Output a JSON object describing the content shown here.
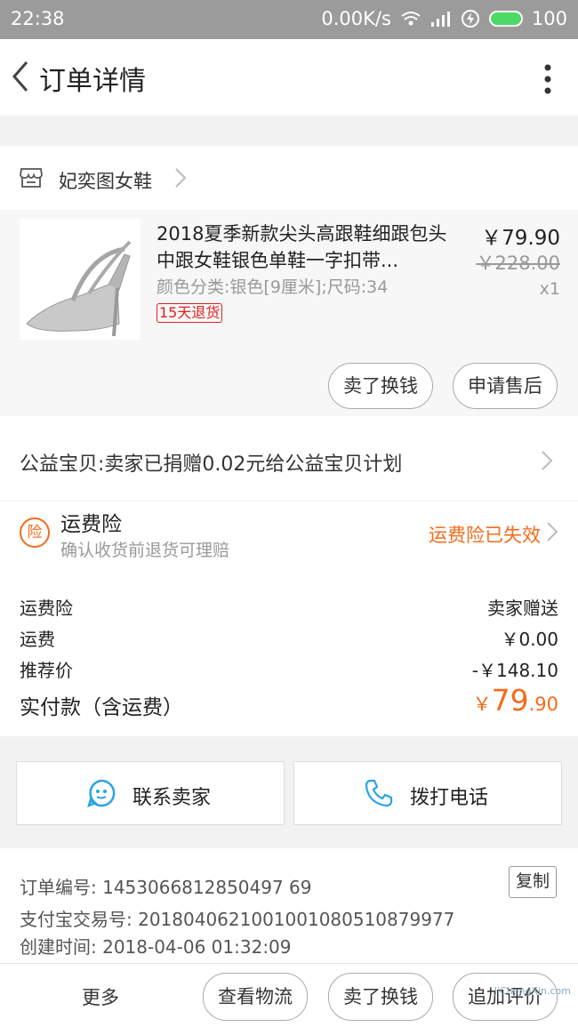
{
  "status_bar": {
    "time": "22:38",
    "network_speed": "0.00K/s",
    "battery": "100"
  },
  "header": {
    "title": "订单详情"
  },
  "shop": {
    "name": "妃奕图女鞋"
  },
  "product": {
    "title": "2018夏季新款尖头高跟鞋细跟包头中跟女鞋银色单鞋一字扣带...",
    "attributes": "颜色分类:银色[9厘米];尺码:34",
    "return_badge": "15天退货",
    "price": "￥79.90",
    "original_price": "￥228.00",
    "quantity": "x1",
    "button_sell": "卖了换钱",
    "button_after_sale": "申请售后"
  },
  "charity": {
    "text": "公益宝贝:卖家已捐赠0.02元给公益宝贝计划"
  },
  "insurance": {
    "icon_char": "险",
    "title": "运费险",
    "subtitle": "确认收货前退货可理赔",
    "status": "运费险已失效"
  },
  "fees": {
    "rows": [
      {
        "label": "运费险",
        "value": "卖家赠送"
      },
      {
        "label": "运费",
        "value": "￥0.00"
      },
      {
        "label": "推荐价",
        "value": "-￥148.10"
      }
    ],
    "total_label": "实付款（含运费）",
    "total_currency": "￥",
    "total_int": "79",
    "total_dec": ".90"
  },
  "contact": {
    "seller": "联系卖家",
    "call": "拨打电话"
  },
  "order_info": {
    "order_no": "订单编号: 1453066812850497 69",
    "alipay_no": "支付宝交易号: 2018040621001001080510879977",
    "created": "创建时间: 2018-04-06 01:32:09",
    "copy": "复制"
  },
  "bottom_bar": {
    "more": "更多",
    "logistics": "查看物流",
    "sell": "卖了换钱",
    "review": "追加评价"
  },
  "watermark": "JiChengXin.com",
  "colors": {
    "accent": "#f46b1b",
    "badge_red": "#e02020",
    "status_bar": "#9b9b9b",
    "battery_green": "#4cd964"
  }
}
